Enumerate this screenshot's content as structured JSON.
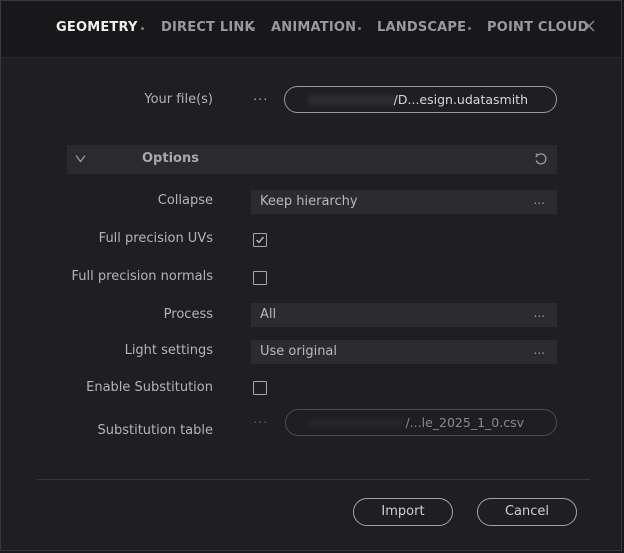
{
  "tabs": [
    {
      "label": "GEOMETRY",
      "active": true
    },
    {
      "label": "DIRECT LINK",
      "active": false
    },
    {
      "label": "ANIMATION",
      "active": false
    },
    {
      "label": "LANDSCAPE",
      "active": false
    },
    {
      "label": "POINT CLOUD",
      "active": false
    }
  ],
  "file": {
    "label": "Your file(s)",
    "browse": "···",
    "value": "/D...esign.udatasmith"
  },
  "options": {
    "title": "Options",
    "collapse": {
      "label": "Collapse",
      "value": "Keep hierarchy",
      "more": "..."
    },
    "full_precision_uvs": {
      "label": "Full precision UVs",
      "checked": true
    },
    "full_precision_normals": {
      "label": "Full precision normals",
      "checked": false
    },
    "process": {
      "label": "Process",
      "value": "All",
      "more": "..."
    },
    "light_settings": {
      "label": "Light settings",
      "value": "Use original",
      "more": "..."
    },
    "enable_substitution": {
      "label": "Enable Substitution",
      "checked": false
    },
    "substitution_table": {
      "label": "Substitution table",
      "browse": "···",
      "value": "/...le_2025_1_0.csv"
    }
  },
  "actions": {
    "import": "Import",
    "cancel": "Cancel"
  },
  "colors": {
    "background": "#1f1f22",
    "tabbar": "#18181a",
    "active_tab": "#f0f0f0",
    "inactive_tab": "#9a9a9d",
    "field": "#2c2c2f"
  }
}
